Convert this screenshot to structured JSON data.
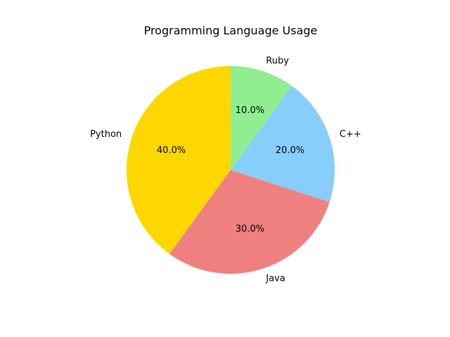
{
  "chart_data": {
    "type": "pie",
    "title": "Programming Language Usage",
    "categories": [
      "Python",
      "Java",
      "C++",
      "Ruby"
    ],
    "values": [
      40,
      30,
      20,
      10
    ],
    "percent_labels": [
      "40.0%",
      "30.0%",
      "20.0%",
      "10.0%"
    ],
    "colors": [
      "#ffd700",
      "#f08080",
      "#87cefa",
      "#90ee90"
    ],
    "start_angle_deg": 90,
    "direction": "counterclockwise"
  }
}
